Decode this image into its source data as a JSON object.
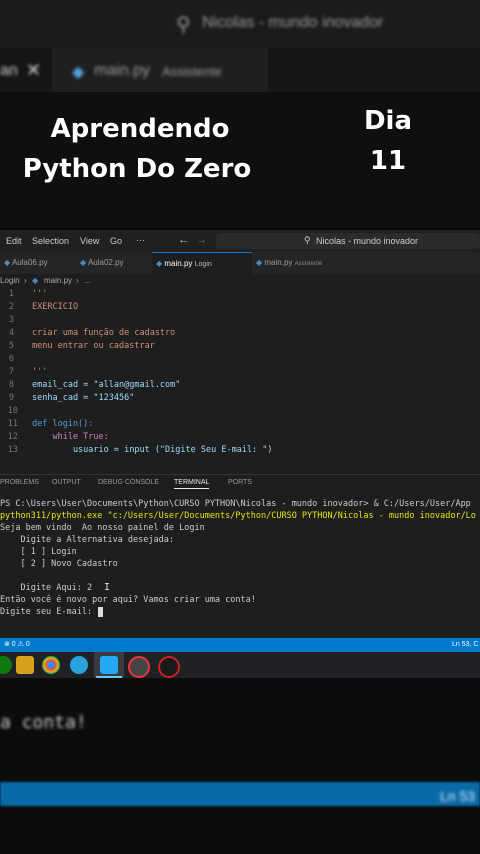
{
  "overlay": {
    "headline_line1": "Aprendendo",
    "headline_line2": "Python Do Zero",
    "day_label": "Dia",
    "day_number": "11"
  },
  "blurred_header": {
    "title": "Nicolas - mundo inovador",
    "tab_label": "main.py",
    "tab_sub": "Assistente",
    "tab_partial": "an"
  },
  "titlebar": {
    "menu": [
      "Edit",
      "Selection",
      "View",
      "Go",
      "···"
    ],
    "search": "Nicolas - mundo inovador"
  },
  "tabs": [
    {
      "label": "Aula06.py",
      "sub": ""
    },
    {
      "label": "Aula02.py",
      "sub": ""
    },
    {
      "label": "main.py",
      "sub": "Login"
    },
    {
      "label": "main.py",
      "sub": "Assistente"
    }
  ],
  "breadcrumb": {
    "left": "Login",
    "file": "main.py",
    "rest": "..."
  },
  "editor_lines": [
    {
      "n": "1",
      "t": "'''"
    },
    {
      "n": "2",
      "t": "EXERCICIO"
    },
    {
      "n": "3",
      "t": ""
    },
    {
      "n": "4",
      "t": "criar uma função de cadastro"
    },
    {
      "n": "5",
      "t": "menu entrar ou cadastrar"
    },
    {
      "n": "6",
      "t": ""
    },
    {
      "n": "7",
      "t": "'''"
    },
    {
      "n": "8",
      "t": "email_cad = \"allan@gmail.com\""
    },
    {
      "n": "9",
      "t": "senha_cad = \"123456\""
    },
    {
      "n": "10",
      "t": ""
    },
    {
      "n": "11",
      "t": "def login():"
    },
    {
      "n": "12",
      "t": "    while True:"
    },
    {
      "n": "13",
      "t": "        usuario = input (\"Digite Seu E-mail: \")"
    }
  ],
  "panel_tabs": [
    "PROBLEMS",
    "OUTPUT",
    "DEBUG CONSOLE",
    "TERMINAL",
    "PORTS"
  ],
  "terminal_lines": [
    "PS C:\\Users\\User\\Documents\\Python\\CURSO PYTHON\\Nicolas - mundo inovador> & C:/Users/User/App",
    "python311/python.exe \"c:/Users/User/Documents/Python/CURSO PYTHON/Nicolas - mundo inovador/Lo",
    "Seja bem vindo  Ao nosso painel de Login",
    "    Digite a Alternativa desejada:",
    "    [ 1 ] Login",
    "    [ 2 ] Novo Cadastro",
    "",
    "    Digite Aqui: 2",
    "Então você é novo por aqui? Vamos criar uma conta!",
    "Digite seu E-mail: "
  ],
  "statusbar": {
    "left": "⊗ 0  ⚠ 0",
    "right": "Ln 53, C"
  },
  "bottom_blur": {
    "text": "a conta!",
    "status": "Ln 53"
  },
  "colors": {
    "status_blue": "#007acc",
    "accent": "#0078d4",
    "string": "#ce9178",
    "keyword": "#569cd6"
  }
}
